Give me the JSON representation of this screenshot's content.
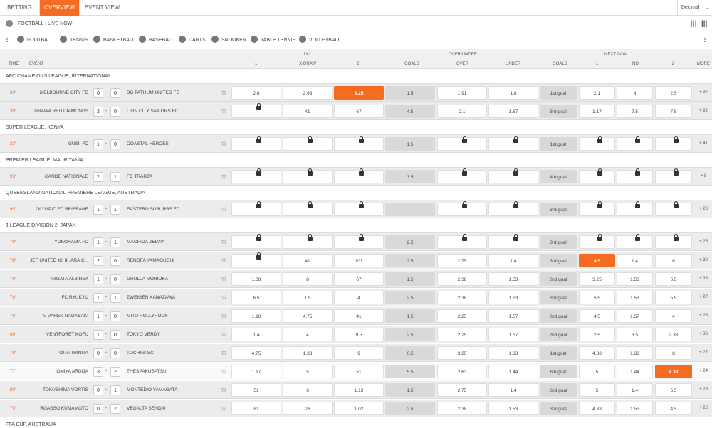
{
  "top_tabs": [
    "BETTING",
    "OVERVIEW",
    "EVENT VIEW"
  ],
  "odds_format": "Decimal",
  "live_label": "FOOTBALL | LIVE NOW!",
  "sports": [
    "FOOTBALL",
    "TENNIS",
    "BASKETBALL",
    "BASEBALL",
    "DARTS",
    "SNOOKER",
    "TABLE TENNIS",
    "VOLLEYBALL"
  ],
  "header": {
    "g1": "1X2",
    "g2": "OVER/UNDER",
    "g3": "NEXT GOAL",
    "time": "TIME",
    "event": "EVENT",
    "c1": "1",
    "cx": "X-DRAW",
    "c2": "2",
    "goals": "GOALS",
    "over": "OVER",
    "under": "UNDER",
    "goals2": "GOALS",
    "n1": "1",
    "no": "NO",
    "n2": "2",
    "more": "MORE"
  },
  "lock_symbol": "lock-icon",
  "accent": "#f36c21",
  "leagues": [
    {
      "name": "AFC CHAMPIONS LEAGUE, INTERNATIONAL",
      "matches": [
        {
          "time": "39'",
          "home": "MELBOURNE CITY FC",
          "hs": "0",
          "as": "0",
          "away": "BG PATHUM UNITED FC",
          "odds": [
            "2.6",
            "2.63",
            "3.25",
            "1.5",
            "1.91",
            "1.8",
            "1st goal",
            "2.1",
            "4",
            "2.5"
          ],
          "more": "+ 97",
          "sel": 2
        },
        {
          "time": "39'",
          "home": "URAWA RED DIAMONDS",
          "hs": "2",
          "as": "0",
          "away": "LION CITY SAILORS FC",
          "odds": [
            "L",
            "41",
            "67",
            "4.5",
            "2.1",
            "1.67",
            "3rd goal",
            "1.17",
            "7.5",
            "7.5"
          ],
          "more": "+ 92",
          "sel": -1
        }
      ]
    },
    {
      "name": "SUPER LEAGUE, KENYA",
      "matches": [
        {
          "time": "33'",
          "home": "GUSII FC",
          "hs": "1",
          "as": "0",
          "away": "COASTAL HEROES",
          "odds": [
            "L",
            "L",
            "L",
            "1.5",
            "L",
            "L",
            "1st goal",
            "L",
            "L",
            "L"
          ],
          "more": "+ 41",
          "sel": -1
        }
      ]
    },
    {
      "name": "PREMIER LEAGUE, MAURITANIA",
      "matches": [
        {
          "time": "93'",
          "home": "GARDE NATIONALE",
          "hs": "2",
          "as": "1",
          "away": "FC TRARZA",
          "odds": [
            "L",
            "L",
            "L",
            "3.5",
            "L",
            "L",
            "4th goal",
            "L",
            "L",
            "L"
          ],
          "more": "+ 8",
          "sel": -1
        }
      ]
    },
    {
      "name": "QUEENSLAND NATIONAL PREMIERE LEAGUE, AUSTRALIA",
      "matches": [
        {
          "time": "95'",
          "home": "OLYMPIC FC BRISBANE",
          "hs": "1",
          "as": "1",
          "away": "EASTERN SUBURBS FC",
          "odds": [
            "L",
            "L",
            "L",
            "",
            "L",
            "L",
            "3rd goal",
            "L",
            "L",
            "L"
          ],
          "more": "+ 20",
          "sel": -1
        }
      ]
    },
    {
      "name": "J-LEAGUE DIVISION 2, JAPAN",
      "matches": [
        {
          "time": "79'",
          "home": "YOKOHAMA FC",
          "hs": "1",
          "as": "1",
          "away": "MACHIDA ZELVIA",
          "odds": [
            "L",
            "L",
            "L",
            "2.5",
            "L",
            "L",
            "3rd goal",
            "L",
            "L",
            "L"
          ],
          "more": "+ 25",
          "sel": -1
        },
        {
          "time": "78'",
          "home": "JEF UNITED ICHIHARA C...",
          "hs": "2",
          "as": "0",
          "away": "RENOFA YAMAGUCHI",
          "odds": [
            "L",
            "41",
            "301",
            "2.5",
            "2.75",
            "1.4",
            "3rd goal",
            "4.5",
            "1.4",
            "6"
          ],
          "more": "+ 30",
          "sel": 7
        },
        {
          "time": "79'",
          "home": "NIIGATA ALBIREX",
          "hs": "1",
          "as": "0",
          "away": "GRULLA MORIOKA",
          "odds": [
            "1.08",
            "8",
            "67",
            "1.5",
            "2.38",
            "1.53",
            "2nd goal",
            "3.25",
            "1.53",
            "6.5"
          ],
          "more": "+ 33",
          "sel": -1
        },
        {
          "time": "79'",
          "home": "FC RYUKYU",
          "hs": "1",
          "as": "1",
          "away": "ZWEIGEN KANAZAWA",
          "odds": [
            "6.5",
            "1.5",
            "4",
            "2.5",
            "2.38",
            "1.53",
            "3rd goal",
            "5.5",
            "1.53",
            "5.5"
          ],
          "more": "+ 27",
          "sel": -1
        },
        {
          "time": "76'",
          "home": "V-VAREN NAGASAKI",
          "hs": "1",
          "as": "0",
          "away": "MITO HOLLYHOCK",
          "odds": [
            "1.18",
            "4.75",
            "41",
            "1.5",
            "2.25",
            "1.57",
            "2nd goal",
            "4.5",
            "1.57",
            "4"
          ],
          "more": "+ 28",
          "sel": -1
        },
        {
          "time": "49'",
          "home": "VENTFORET KOFU",
          "hs": "1",
          "as": "0",
          "away": "TOKYO VERDY",
          "odds": [
            "1.4",
            "4",
            "9.5",
            "2.5",
            "2.25",
            "1.57",
            "2nd goal",
            "2.5",
            "3.5",
            "2.38"
          ],
          "more": "+ 36",
          "sel": -1
        },
        {
          "time": "79'",
          "home": "OITA TRINITA",
          "hs": "0",
          "as": "0",
          "away": "TOCHIGI SC",
          "odds": [
            "4.75",
            "1.33",
            "9",
            "0.5",
            "3.25",
            "1.33",
            "1st goal",
            "4.33",
            "1.33",
            "8"
          ],
          "more": "+ 27",
          "sel": -1
        },
        {
          "time": "77'",
          "home": "OMIYA ARDIJA",
          "hs": "3",
          "as": "2",
          "away": "THESPAKUSATSU",
          "odds": [
            "1.17",
            "5",
            "51",
            "5.5",
            "2.63",
            "1.44",
            "6th goal",
            "5",
            "1.44",
            "4.33"
          ],
          "more": "+ 24",
          "sel": 9
        },
        {
          "time": "80'",
          "home": "TOKUSHIMA VORTIS",
          "hs": "0",
          "as": "1",
          "away": "MONTEDIO YAMAGATA",
          "odds": [
            "51",
            "6",
            "1.13",
            "1.5",
            "2.75",
            "1.4",
            "2nd goal",
            "5",
            "1.4",
            "5.5"
          ],
          "more": "+ 28",
          "sel": -1
        },
        {
          "time": "79'",
          "home": "ROASSO KUMAMOTO",
          "hs": "0",
          "as": "2",
          "away": "VEGALTA SENDAI",
          "odds": [
            "81",
            "26",
            "1.02",
            "2.5",
            "2.38",
            "1.53",
            "3rd goal",
            "4.33",
            "1.53",
            "4.5"
          ],
          "more": "+ 25",
          "sel": -1
        }
      ]
    },
    {
      "name": "FFA CUP, AUSTRALIA",
      "matches": []
    }
  ]
}
